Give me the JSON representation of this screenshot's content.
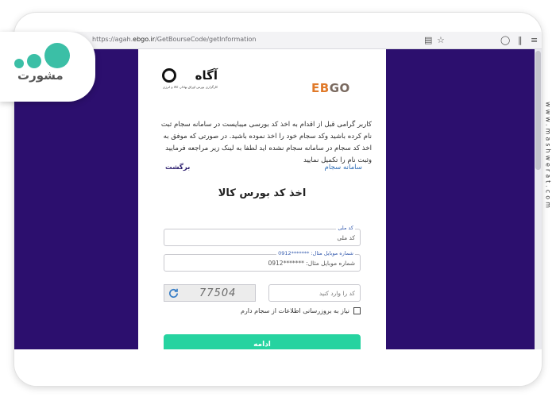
{
  "browser": {
    "url_prefix": "https://agah.",
    "url_domain": "ebgo.ir",
    "url_path": "/GetBourseCode/getInformation"
  },
  "logos": {
    "agah_title": "آگاه",
    "agah_subtitle": "کارگزاری بورس اوراق بهادار، کالا و انرژی",
    "ebgo_e": "EB",
    "ebgo_rest": "GO"
  },
  "notice": "کاربر گرامی قبل از اقدام به اخذ کد بورسی میبایست در سامانه سجام ثبت نام کرده باشید وکد سجام خود را اخذ نموده باشید. در صورتی که موفق به اخذ کد سجام در سامانه سجام نشده اید لطفا به لینک زیر مراجعه فرمایید وثبت نام را تکمیل نمایید",
  "links": {
    "sajam": "سامانه سجام",
    "back": "برگشت"
  },
  "form": {
    "title": "اخذ کد بورس کالا",
    "national_code_label": "کد ملی",
    "national_code_placeholder": "کد ملی",
    "mobile_label": "شماره موبایل مثال: *******0912",
    "mobile_placeholder": "شماره موبایل مثال: *******0912",
    "captcha_value": "77504",
    "captcha_placeholder": "کد  را وارد کنید",
    "checkbox_label": "نیاز به بروزرسانی اطلاعات از سجام دارم",
    "submit_label": "ادامه"
  },
  "brand": {
    "badge_text": "مشورت",
    "watermark": "www.mashwerat.com"
  },
  "colors": {
    "background": "#2c0f6e",
    "submit": "#26d3a0",
    "link": "#2c6bb5",
    "badge_dots": "#3bbfa6"
  }
}
